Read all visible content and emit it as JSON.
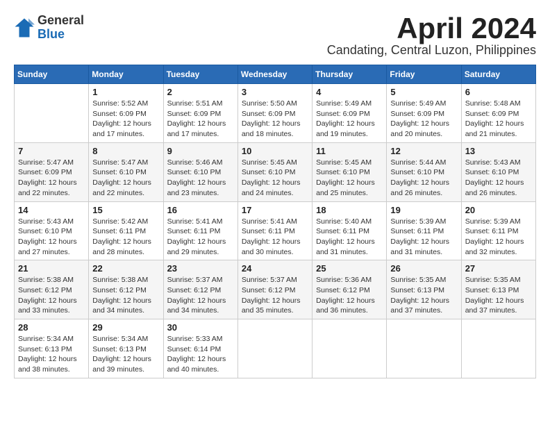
{
  "header": {
    "logo_general": "General",
    "logo_blue": "Blue",
    "month_title": "April 2024",
    "location": "Candating, Central Luzon, Philippines"
  },
  "weekdays": [
    "Sunday",
    "Monday",
    "Tuesday",
    "Wednesday",
    "Thursday",
    "Friday",
    "Saturday"
  ],
  "weeks": [
    [
      {
        "day": "",
        "info": ""
      },
      {
        "day": "1",
        "info": "Sunrise: 5:52 AM\nSunset: 6:09 PM\nDaylight: 12 hours\nand 17 minutes."
      },
      {
        "day": "2",
        "info": "Sunrise: 5:51 AM\nSunset: 6:09 PM\nDaylight: 12 hours\nand 17 minutes."
      },
      {
        "day": "3",
        "info": "Sunrise: 5:50 AM\nSunset: 6:09 PM\nDaylight: 12 hours\nand 18 minutes."
      },
      {
        "day": "4",
        "info": "Sunrise: 5:49 AM\nSunset: 6:09 PM\nDaylight: 12 hours\nand 19 minutes."
      },
      {
        "day": "5",
        "info": "Sunrise: 5:49 AM\nSunset: 6:09 PM\nDaylight: 12 hours\nand 20 minutes."
      },
      {
        "day": "6",
        "info": "Sunrise: 5:48 AM\nSunset: 6:09 PM\nDaylight: 12 hours\nand 21 minutes."
      }
    ],
    [
      {
        "day": "7",
        "info": "Sunrise: 5:47 AM\nSunset: 6:09 PM\nDaylight: 12 hours\nand 22 minutes."
      },
      {
        "day": "8",
        "info": "Sunrise: 5:47 AM\nSunset: 6:10 PM\nDaylight: 12 hours\nand 22 minutes."
      },
      {
        "day": "9",
        "info": "Sunrise: 5:46 AM\nSunset: 6:10 PM\nDaylight: 12 hours\nand 23 minutes."
      },
      {
        "day": "10",
        "info": "Sunrise: 5:45 AM\nSunset: 6:10 PM\nDaylight: 12 hours\nand 24 minutes."
      },
      {
        "day": "11",
        "info": "Sunrise: 5:45 AM\nSunset: 6:10 PM\nDaylight: 12 hours\nand 25 minutes."
      },
      {
        "day": "12",
        "info": "Sunrise: 5:44 AM\nSunset: 6:10 PM\nDaylight: 12 hours\nand 26 minutes."
      },
      {
        "day": "13",
        "info": "Sunrise: 5:43 AM\nSunset: 6:10 PM\nDaylight: 12 hours\nand 26 minutes."
      }
    ],
    [
      {
        "day": "14",
        "info": "Sunrise: 5:43 AM\nSunset: 6:10 PM\nDaylight: 12 hours\nand 27 minutes."
      },
      {
        "day": "15",
        "info": "Sunrise: 5:42 AM\nSunset: 6:11 PM\nDaylight: 12 hours\nand 28 minutes."
      },
      {
        "day": "16",
        "info": "Sunrise: 5:41 AM\nSunset: 6:11 PM\nDaylight: 12 hours\nand 29 minutes."
      },
      {
        "day": "17",
        "info": "Sunrise: 5:41 AM\nSunset: 6:11 PM\nDaylight: 12 hours\nand 30 minutes."
      },
      {
        "day": "18",
        "info": "Sunrise: 5:40 AM\nSunset: 6:11 PM\nDaylight: 12 hours\nand 31 minutes."
      },
      {
        "day": "19",
        "info": "Sunrise: 5:39 AM\nSunset: 6:11 PM\nDaylight: 12 hours\nand 31 minutes."
      },
      {
        "day": "20",
        "info": "Sunrise: 5:39 AM\nSunset: 6:11 PM\nDaylight: 12 hours\nand 32 minutes."
      }
    ],
    [
      {
        "day": "21",
        "info": "Sunrise: 5:38 AM\nSunset: 6:12 PM\nDaylight: 12 hours\nand 33 minutes."
      },
      {
        "day": "22",
        "info": "Sunrise: 5:38 AM\nSunset: 6:12 PM\nDaylight: 12 hours\nand 34 minutes."
      },
      {
        "day": "23",
        "info": "Sunrise: 5:37 AM\nSunset: 6:12 PM\nDaylight: 12 hours\nand 34 minutes."
      },
      {
        "day": "24",
        "info": "Sunrise: 5:37 AM\nSunset: 6:12 PM\nDaylight: 12 hours\nand 35 minutes."
      },
      {
        "day": "25",
        "info": "Sunrise: 5:36 AM\nSunset: 6:12 PM\nDaylight: 12 hours\nand 36 minutes."
      },
      {
        "day": "26",
        "info": "Sunrise: 5:35 AM\nSunset: 6:13 PM\nDaylight: 12 hours\nand 37 minutes."
      },
      {
        "day": "27",
        "info": "Sunrise: 5:35 AM\nSunset: 6:13 PM\nDaylight: 12 hours\nand 37 minutes."
      }
    ],
    [
      {
        "day": "28",
        "info": "Sunrise: 5:34 AM\nSunset: 6:13 PM\nDaylight: 12 hours\nand 38 minutes."
      },
      {
        "day": "29",
        "info": "Sunrise: 5:34 AM\nSunset: 6:13 PM\nDaylight: 12 hours\nand 39 minutes."
      },
      {
        "day": "30",
        "info": "Sunrise: 5:33 AM\nSunset: 6:14 PM\nDaylight: 12 hours\nand 40 minutes."
      },
      {
        "day": "",
        "info": ""
      },
      {
        "day": "",
        "info": ""
      },
      {
        "day": "",
        "info": ""
      },
      {
        "day": "",
        "info": ""
      }
    ]
  ]
}
